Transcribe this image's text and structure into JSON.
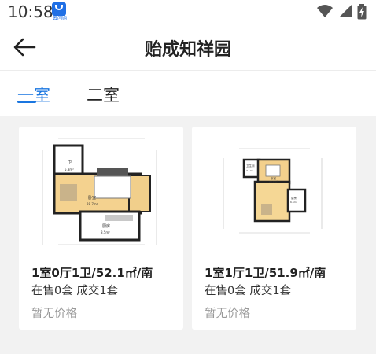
{
  "status_bar": {
    "time": "10:58",
    "app_icon_label": "云闪购",
    "icons": [
      "wifi-icon",
      "signal-icon",
      "battery-charging-icon"
    ]
  },
  "header": {
    "title": "贻成知祥园",
    "back_icon": "arrow-left-icon"
  },
  "tabs": [
    {
      "label": "一室",
      "active": true
    },
    {
      "label": "二室",
      "active": false
    }
  ],
  "colors": {
    "accent": "#1a76e0",
    "background": "#f2f2f2",
    "muted_text": "#999999"
  },
  "cards": [
    {
      "title": "1室0厅1卫/52.1㎡/南",
      "sales": "在售0套 成交1套",
      "price": "暂无价格",
      "plan_rooms": [
        "卫",
        "卧室",
        "厨房"
      ],
      "plan_areas": [
        "5.8m²",
        "28.7m²",
        "8.5m²"
      ]
    },
    {
      "title": "1室1厅1卫/51.9㎡/南",
      "sales": "在售0套 成交1套",
      "price": "暂无价格",
      "plan_rooms": [
        "卫生间",
        "卧室",
        "厨房"
      ],
      "plan_areas": [
        "3.1m²",
        "20.7m²",
        "6.5m²"
      ]
    }
  ]
}
